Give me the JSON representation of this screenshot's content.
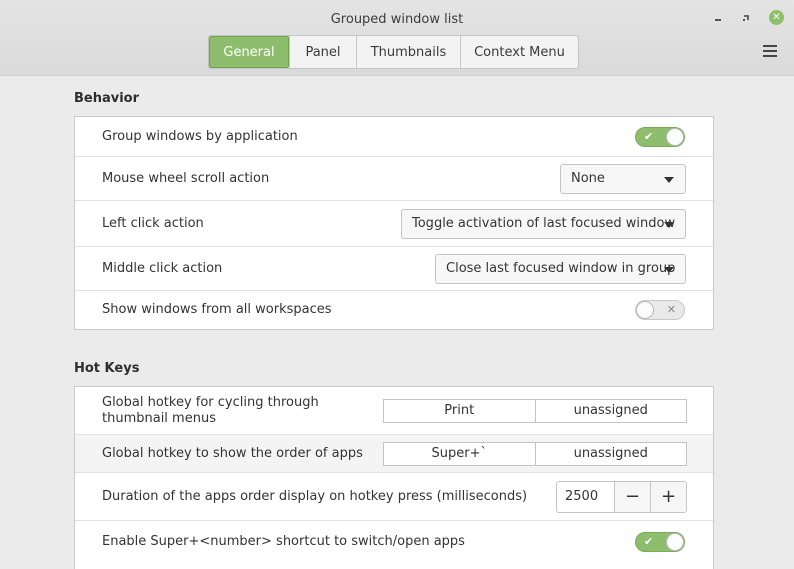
{
  "window": {
    "title": "Grouped window list",
    "controls": {
      "minimize": "minimize-icon",
      "maximize": "restore-icon",
      "close": "close-icon"
    }
  },
  "tabs": [
    {
      "label": "General",
      "active": true
    },
    {
      "label": "Panel",
      "active": false
    },
    {
      "label": "Thumbnails",
      "active": false
    },
    {
      "label": "Context Menu",
      "active": false
    }
  ],
  "menu_icon": "hamburger-menu-icon",
  "behavior": {
    "title": "Behavior",
    "group_windows": {
      "label": "Group windows by application",
      "value": true
    },
    "scroll_action": {
      "label": "Mouse wheel scroll action",
      "value": "None"
    },
    "left_click": {
      "label": "Left click action",
      "value": "Toggle activation of last focused window"
    },
    "middle_click": {
      "label": "Middle click action",
      "value": "Close last focused window in group"
    },
    "all_workspaces": {
      "label": "Show windows from all workspaces",
      "value": false
    }
  },
  "hotkeys": {
    "title": "Hot Keys",
    "cycle_thumbnails": {
      "label": "Global hotkey for cycling through thumbnail menus",
      "primary": "Print",
      "secondary": "unassigned"
    },
    "show_order": {
      "label": "Global hotkey to show the order of apps",
      "primary": "Super+`",
      "secondary": "unassigned"
    },
    "order_duration": {
      "label": "Duration of the apps order display on hotkey press (milliseconds)",
      "value": "2500",
      "decrement": "−",
      "increment": "+"
    },
    "super_number": {
      "label": "Enable Super+<number> shortcut to switch/open apps",
      "value": true
    }
  },
  "colors": {
    "accent": "#8fbd6e",
    "close_button": "#8ec06b",
    "window_bg": "#ebebeb"
  }
}
